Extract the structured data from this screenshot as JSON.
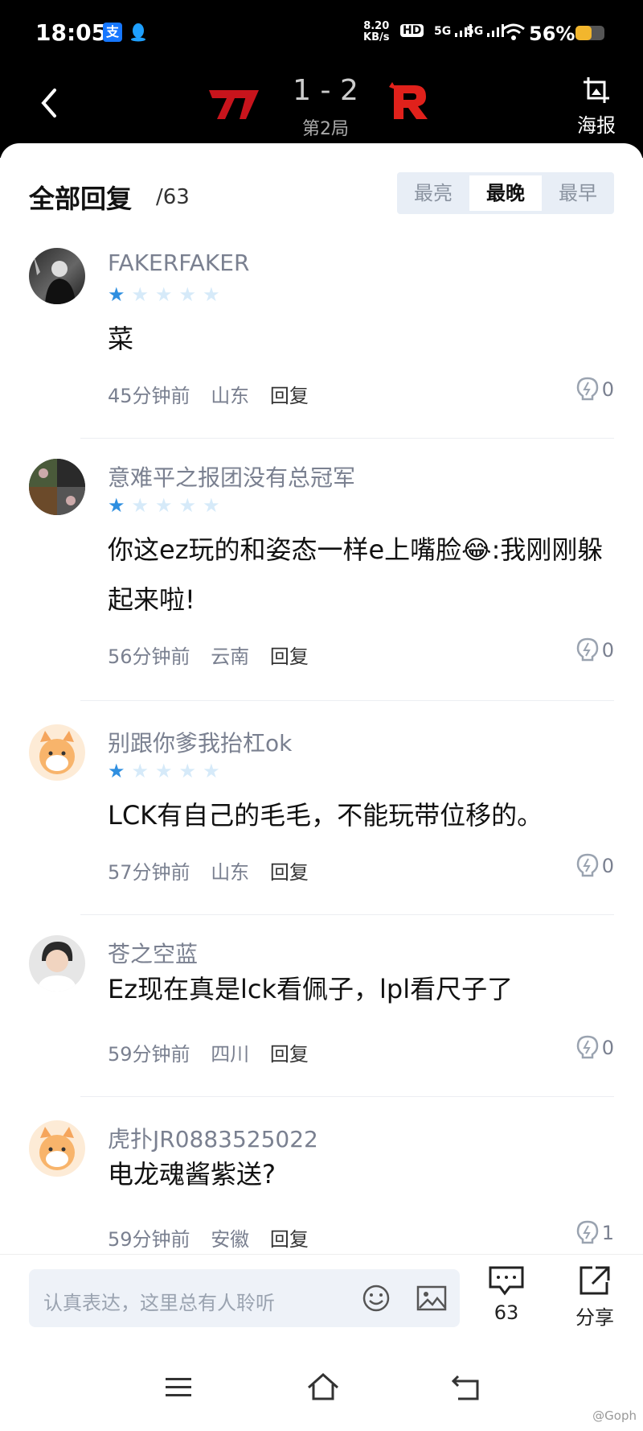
{
  "status_bar": {
    "time": "18:05",
    "net_speed_value": "8.20",
    "net_speed_unit": "KB/s",
    "hd_label": "HD",
    "sig1": "5G",
    "sig2": "5G",
    "battery_percent": "56%",
    "battery_level": 0.56,
    "battery_color": "#f2b62d"
  },
  "header": {
    "score": "1 - 2",
    "game": "第2局",
    "poster_label": "海报"
  },
  "replies": {
    "title": "全部回复",
    "count": "/63",
    "sort_tabs": [
      "最亮",
      "最晚",
      "最早"
    ],
    "active_tab": "最晚"
  },
  "comments": [
    {
      "user": "FAKERFAKER",
      "rating": 1,
      "text": "菜",
      "time": "45分钟前",
      "location": "山东",
      "reply": "回复",
      "likes": "0"
    },
    {
      "user": "意难平之报团没有总冠军",
      "rating": 1,
      "text": "你这ez玩的和姿态一样e上嘴脸😂:我刚刚躲起来啦!",
      "time": "56分钟前",
      "location": "云南",
      "reply": "回复",
      "likes": "0"
    },
    {
      "user": "别跟你爹我抬杠ok",
      "rating": 1,
      "text": "LCK有自己的毛毛，不能玩带位移的。",
      "time": "57分钟前",
      "location": "山东",
      "reply": "回复",
      "likes": "0"
    },
    {
      "user": "苍之空蓝",
      "rating": 0,
      "text": "Ez现在真是lck看佩子，lpl看尺子了",
      "time": "59分钟前",
      "location": "四川",
      "reply": "回复",
      "likes": "0"
    },
    {
      "user": "虎扑JR0883525022",
      "rating": 0,
      "text": "电龙魂酱紫送?",
      "time": "59分钟前",
      "location": "安徽",
      "reply": "回复",
      "likes": "1"
    }
  ],
  "bottom_bar": {
    "input_placeholder": "认真表达，这里总有人聆听",
    "comment_count": "63",
    "share_label": "分享"
  },
  "watermark": "@Goph",
  "colors": {
    "accent": "#2f8fe0",
    "team2": "#e0211b",
    "team1": "#c8141c"
  }
}
